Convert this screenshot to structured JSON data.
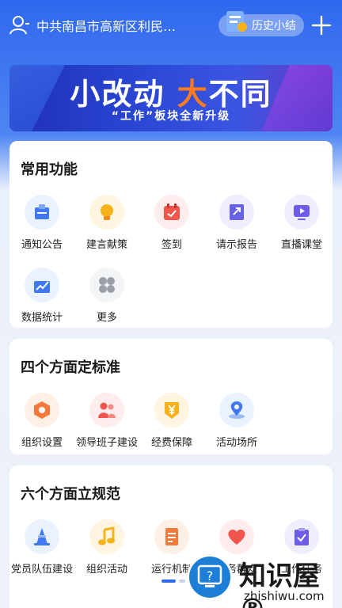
{
  "header": {
    "org_name": "中共南昌市高新区利民…",
    "history_label": "历史小结"
  },
  "banner": {
    "title_part1": "小改动",
    "title_part2": "大",
    "title_part3": "不同",
    "subtitle": "“工作”板块全新升级"
  },
  "common": {
    "title": "常用功能",
    "items": [
      {
        "label": "通知公告",
        "icon": "notice-icon",
        "color": "#3f78f0"
      },
      {
        "label": "建言献策",
        "icon": "bulb-icon",
        "color": "#f6b21b"
      },
      {
        "label": "签到",
        "icon": "calendar-icon",
        "color": "#f0554e"
      },
      {
        "label": "请示报告",
        "icon": "report-icon",
        "color": "#6a62e6"
      },
      {
        "label": "直播课堂",
        "icon": "live-icon",
        "color": "#6b5de8"
      },
      {
        "label": "数据统计",
        "icon": "chart-icon",
        "color": "#3f78f0"
      },
      {
        "label": "更多",
        "icon": "more-icon",
        "color": "#9aa0a8"
      }
    ]
  },
  "standards": {
    "title": "四个方面定标准",
    "items": [
      {
        "label": "组织设置",
        "icon": "hexagon-icon",
        "color": "#f5793b"
      },
      {
        "label": "领导班子建设",
        "icon": "team-icon",
        "color": "#f0554e"
      },
      {
        "label": "经费保障",
        "icon": "yen-icon",
        "color": "#f6b21b"
      },
      {
        "label": "活动场所",
        "icon": "location-icon",
        "color": "#3f78f0"
      }
    ]
  },
  "norms": {
    "title": "六个方面立规范",
    "items": [
      {
        "label": "党员队伍建设",
        "icon": "cone-icon",
        "color": "#3f78f0"
      },
      {
        "label": "组织活动",
        "icon": "music-icon",
        "color": "#f6b21b"
      },
      {
        "label": "运行机制",
        "icon": "document-icon",
        "color": "#f5793b"
      },
      {
        "label": "服务群众",
        "icon": "heart-icon",
        "color": "#f0554e"
      },
      {
        "label": "工作任务",
        "icon": "task-icon",
        "color": "#6b5de8"
      }
    ]
  },
  "watermark": {
    "brand": "知识屋®",
    "url": "zhishiwu.com"
  }
}
